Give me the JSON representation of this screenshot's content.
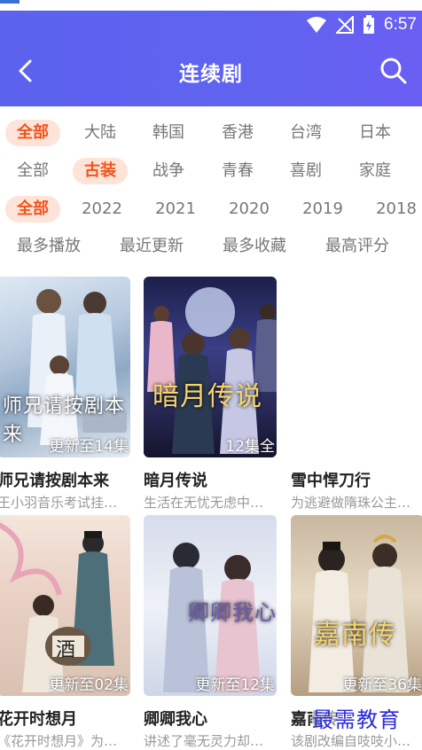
{
  "status": {
    "time": "6:57"
  },
  "header": {
    "title": "连续剧"
  },
  "filters": {
    "region": [
      "全部",
      "大陆",
      "韩国",
      "香港",
      "台湾",
      "日本"
    ],
    "genre": [
      "全部",
      "古装",
      "战争",
      "青春",
      "喜剧",
      "家庭"
    ],
    "year": [
      "全部",
      "2022",
      "2021",
      "2020",
      "2019",
      "2018"
    ],
    "sort": [
      "最多播放",
      "最近更新",
      "最多收藏",
      "最高评分"
    ]
  },
  "cards": [
    {
      "title": "师兄请按剧本来",
      "desc": "王小羽音乐考试挂…",
      "badge": "更新至14集",
      "poster_text": "师兄请按剧本来"
    },
    {
      "title": "暗月传说",
      "desc": "生活在无忧无虑中…",
      "badge": "12集全",
      "poster_text": "暗月传说"
    },
    {
      "title": "雪中悍刀行",
      "desc": "为逃避做隋珠公主…",
      "badge": "",
      "poster_text": ""
    },
    {
      "title": "花开时想月",
      "desc": "《花开时想月》为…",
      "badge": "更新至02集",
      "poster_text": "酒"
    },
    {
      "title": "卿卿我心",
      "desc": "讲述了毫无灵力却…",
      "badge": "更新至12集",
      "poster_text": "卿卿我心"
    },
    {
      "title": "嘉南传",
      "desc": "该剧改编自吱吱小…",
      "badge": "更新至36集",
      "poster_text": "嘉南传"
    }
  ],
  "watermark": "最需教育",
  "colors": {
    "header": "#5f63f0",
    "accent": "#f3531c",
    "chip_bg": "#fde3d8"
  }
}
